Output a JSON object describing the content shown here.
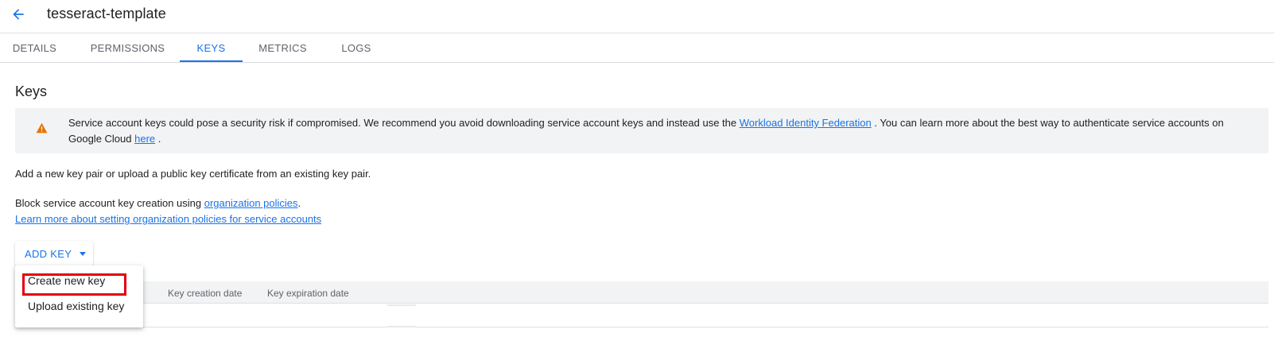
{
  "header": {
    "title": "tesseract-template",
    "back_icon": "arrow-back-icon"
  },
  "tabs": [
    {
      "label": "DETAILS",
      "active": false
    },
    {
      "label": "PERMISSIONS",
      "active": false
    },
    {
      "label": "KEYS",
      "active": true
    },
    {
      "label": "METRICS",
      "active": false
    },
    {
      "label": "LOGS",
      "active": false
    }
  ],
  "section": {
    "title": "Keys"
  },
  "alert": {
    "icon": "warning-icon",
    "text_before": "Service account keys could pose a security risk if compromised. We recommend you avoid downloading service account keys and instead use the ",
    "link1": "Workload Identity Federation",
    "text_middle": " . You can learn more about the best way to authenticate service accounts on Google Cloud ",
    "link2": "here",
    "text_after": " ."
  },
  "body": {
    "add_text": "Add a new key pair or upload a public key certificate from an existing key pair.",
    "block_text": "Block service account key creation using ",
    "policies_link": "organization policies",
    "period": ".",
    "learn_more_link": "Learn more about setting organization policies for service accounts"
  },
  "add_key": {
    "label": "ADD KEY",
    "caret_icon": "dropdown-caret-icon"
  },
  "table": {
    "headers": [
      "Key creation date",
      "Key expiration date"
    ]
  },
  "menu": {
    "items": [
      "Create new key",
      "Upload existing key"
    ]
  },
  "colors": {
    "accent": "#1a73e8",
    "warning": "#e37400",
    "highlight": "#e3000f"
  }
}
